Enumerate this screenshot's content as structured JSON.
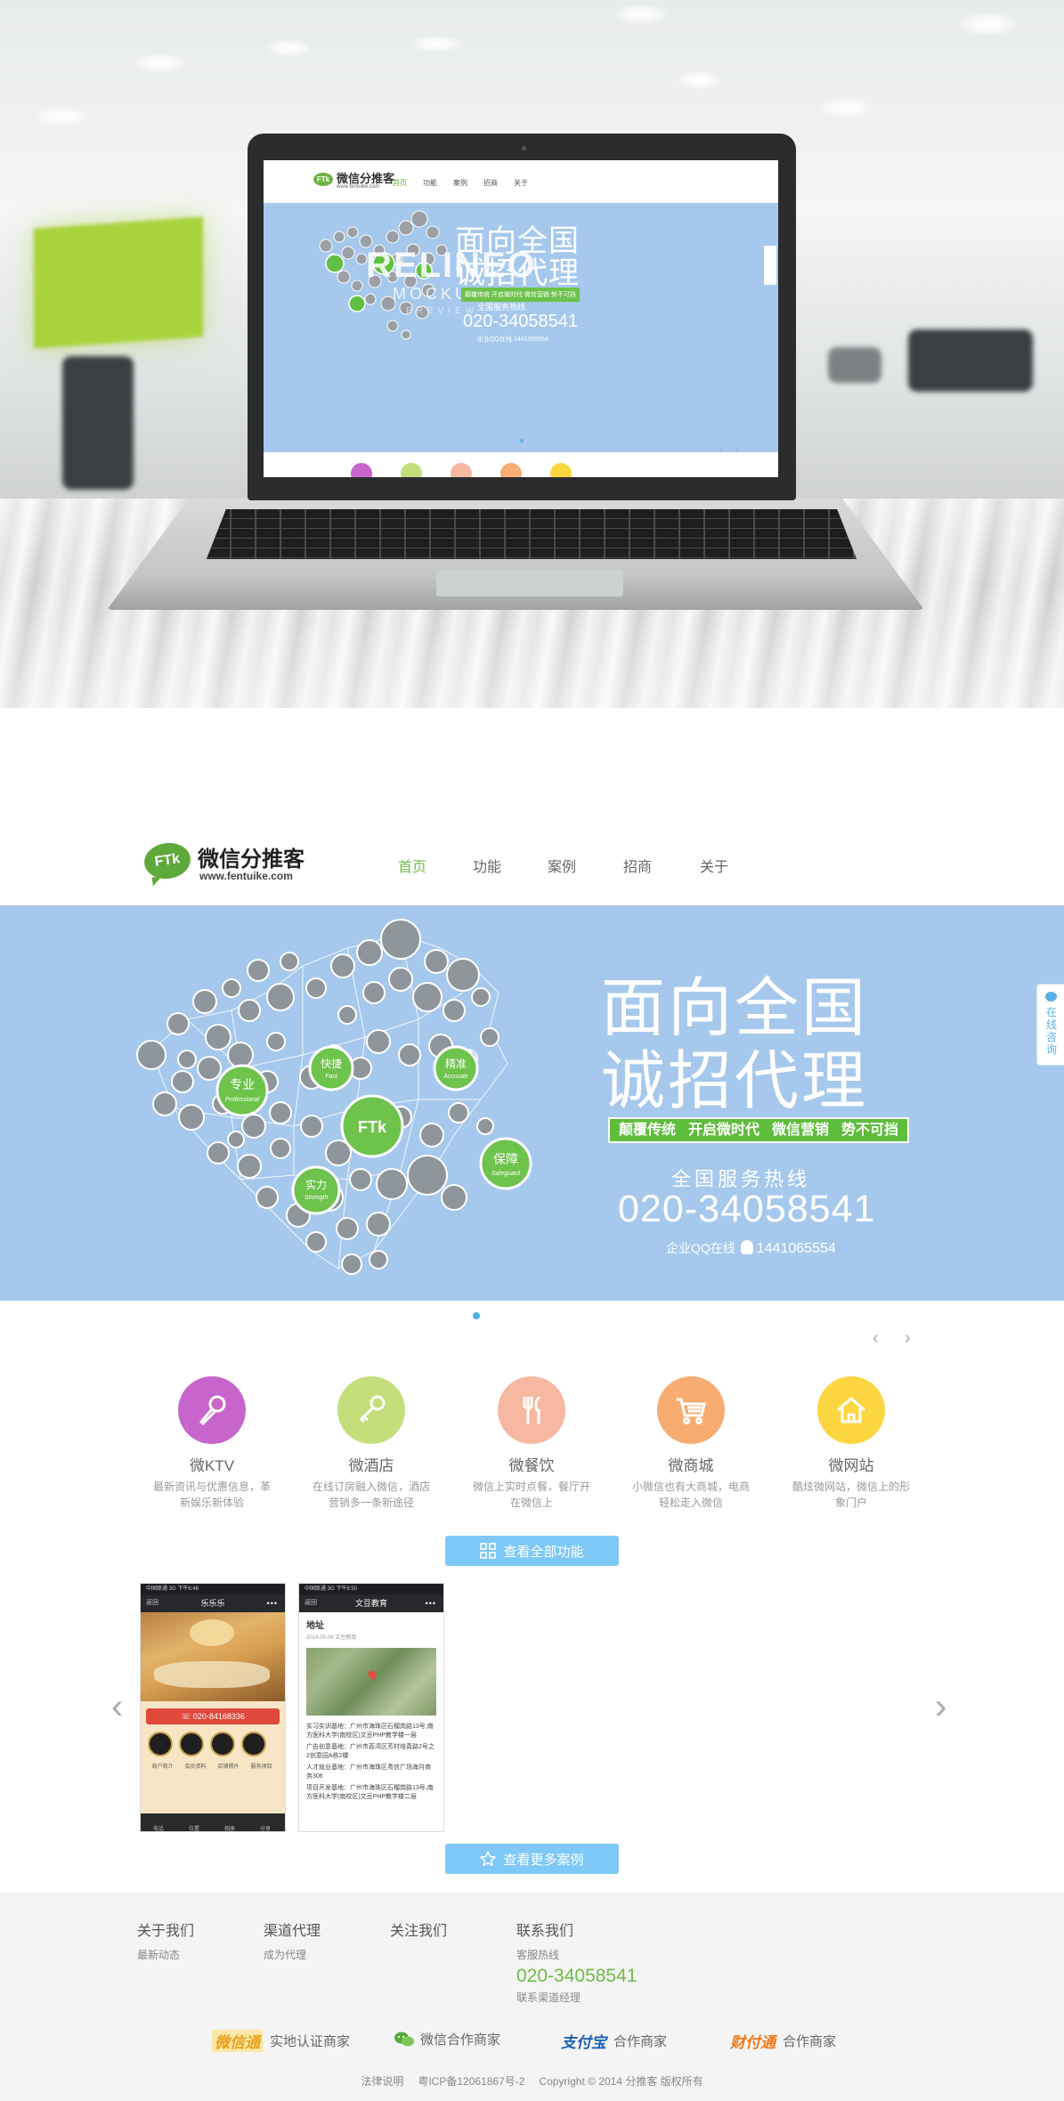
{
  "mockup": {
    "logo_name": "微信分推客",
    "logo_url": "www.fentuike.com",
    "nav": [
      "首页",
      "功能",
      "案例",
      "招商",
      "关于"
    ],
    "title_lines": [
      "面向全国",
      "诚招代理"
    ],
    "tags": "颠覆传统  开启微时代  微信营销  势不可挡",
    "hotline": "全国服务热线",
    "phone": "020-34058541",
    "qq": "企业QQ在线  1441065554",
    "watermark_1": "RELINEO",
    "watermark_2": "MOCKUP",
    "watermark_3": "PREVIEW"
  },
  "header": {
    "logo_badge": "FTk",
    "logo_name": "微信分推客",
    "logo_url": "www.fentuike.com",
    "nav": [
      {
        "label": "首页",
        "active": true
      },
      {
        "label": "功能",
        "active": false
      },
      {
        "label": "案例",
        "active": false
      },
      {
        "label": "招商",
        "active": false
      },
      {
        "label": "关于",
        "active": false
      }
    ]
  },
  "banner": {
    "title_line1": "面向全国",
    "title_line2": "诚招代理",
    "tags": [
      "颠覆传统",
      "开启微时代",
      "微信营销",
      "势不可挡"
    ],
    "hotline_label": "全国服务热线",
    "phone": "020-34058541",
    "qq_label": "企业QQ在线",
    "qq_number": "1441065554",
    "map_center": "FTk",
    "map_badges": [
      {
        "cn": "专业",
        "en": "Professional"
      },
      {
        "cn": "快捷",
        "en": "Fast"
      },
      {
        "cn": "精准",
        "en": "Accurate"
      },
      {
        "cn": "保障",
        "en": "Safeguard"
      },
      {
        "cn": "实力",
        "en": "Strength"
      }
    ]
  },
  "side_service": {
    "label": "在线咨询"
  },
  "slider": {
    "prev": "‹",
    "next": "›"
  },
  "features": [
    {
      "name": "微KTV",
      "desc": "最新资讯与优惠信息，革新娱乐新体验",
      "color": "#c765cc",
      "icon": "microphone-icon"
    },
    {
      "name": "微酒店",
      "desc": "在线订房融入微信，酒店营销多一条新途径",
      "color": "#c3de7b",
      "icon": "key-icon"
    },
    {
      "name": "微餐饮",
      "desc": "微信上实时点餐，餐厅开在微信上",
      "color": "#f7b8a2",
      "icon": "cutlery-icon"
    },
    {
      "name": "微商城",
      "desc": "小微信也有大商城，电商轻松走入微信",
      "color": "#f8ac72",
      "icon": "cart-icon"
    },
    {
      "name": "微网站",
      "desc": "酷炫微网站，微信上的形象门户",
      "color": "#fcd640",
      "icon": "house-icon"
    }
  ],
  "buttons": {
    "all_features": "查看全部功能",
    "more_cases": "查看更多案例"
  },
  "cases": {
    "prev": "‹",
    "next": "›",
    "case1": {
      "status": "中国联通  3G  下午6:48",
      "back": "返回",
      "title": "乐乐乐",
      "menu": "•••",
      "call": "020-84168336",
      "labels": [
        "商户简介",
        "会员资料",
        "店铺照片",
        "服务项目"
      ],
      "tabs": [
        "电话",
        "位置",
        "相册",
        "分享"
      ]
    },
    "case2": {
      "status": "中国联通  3G  下午6:50",
      "back": "返回",
      "title": "文豆教育",
      "menu": "•••",
      "heading": "地址",
      "date": "2014-05-06  文豆教育",
      "lines": [
        "实习实训基地：广州市海珠区石榴岗路13号,南方医科大学(南校区)文豆PHP教学楼一层",
        "广告创意基地：广州市荔湾区芳村培真路2号之2创意园A栋2楼",
        "人才就业基地：广州市海珠区粤信广场海月商务306",
        "项目开发基地：广州市海珠区石榴岗路13号,南方医科大学(南校区)文豆PHP教学楼二层"
      ]
    }
  },
  "footer": {
    "about": {
      "title": "关于我们",
      "link": "最新动态"
    },
    "channel": {
      "title": "渠道代理",
      "link": "成为代理"
    },
    "follow": {
      "title": "关注我们"
    },
    "contact": {
      "title": "联系我们",
      "hotline_label": "客服热线",
      "phone": "020-34058541",
      "manager": "联系渠道经理"
    },
    "partners": [
      {
        "logo": "微信通",
        "label": "实地认证商家",
        "color": "#e8a21f"
      },
      {
        "logo": "微信",
        "label": "微信合作商家",
        "color": "#59a93d"
      },
      {
        "logo": "支付宝",
        "label": "合作商家",
        "color": "#1a5fb4"
      },
      {
        "logo": "财付通",
        "label": "合作商家",
        "color": "#f07a1a"
      }
    ],
    "legal": "法律说明",
    "icp": "粤ICP备12061867号-2",
    "copyright": "Copyright © 2014 分推客 版权所有"
  }
}
